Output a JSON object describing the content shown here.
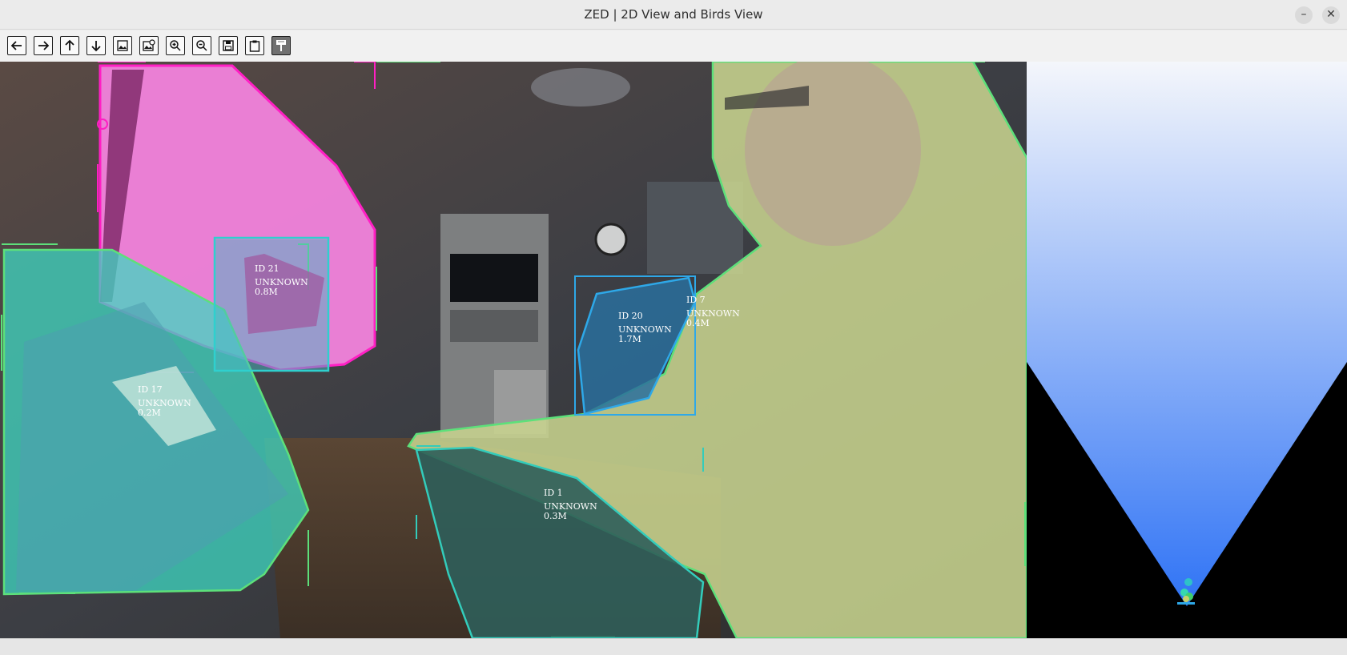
{
  "window": {
    "title": "ZED | 2D View and Birds View",
    "minimize_symbol": "–",
    "close_symbol": "✕"
  },
  "toolbar": {
    "buttons": [
      {
        "name": "back-icon"
      },
      {
        "name": "forward-icon"
      },
      {
        "name": "up-icon"
      },
      {
        "name": "down-icon"
      },
      {
        "name": "image-icon"
      },
      {
        "name": "image-settings-icon"
      },
      {
        "name": "zoom-in-icon"
      },
      {
        "name": "zoom-out-icon"
      },
      {
        "name": "save-icon"
      },
      {
        "name": "clipboard-icon"
      },
      {
        "name": "paint-icon",
        "active": true
      }
    ]
  },
  "detections": [
    {
      "id_label": "ID 21",
      "class_label": "UNKNOWN",
      "distance": "0.8M",
      "color": "#ff22cc"
    },
    {
      "id_label": "ID 17",
      "class_label": "UNKNOWN",
      "distance": "0.2M",
      "color": "#66dd66"
    },
    {
      "id_label": "ID 20",
      "class_label": "UNKNOWN",
      "distance": "1.7M",
      "color": "#2ea8e8"
    },
    {
      "id_label": "ID 7",
      "class_label": "UNKNOWN",
      "distance": "0.4M",
      "color": "#66dd66"
    },
    {
      "id_label": "ID 1",
      "class_label": "UNKNOWN",
      "distance": "0.3M",
      "color": "#33ccbb"
    }
  ],
  "birds_view": {
    "gradient_top": "#f4f6fb",
    "gradient_bottom": "#2f73f5",
    "background": "#000000"
  }
}
